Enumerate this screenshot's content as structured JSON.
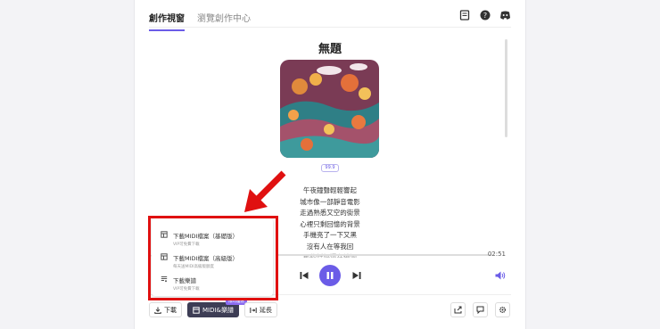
{
  "tabs": [
    "創作視窗",
    "瀏覽創作中心"
  ],
  "song": {
    "title": "無題",
    "tag": "99.9"
  },
  "lyrics": [
    "午夜鐘聲輕輕響起",
    "城市像一部靜音電影",
    "走過熟悉又空的街景",
    "心裡只剩回憶的背景",
    "手機亮了一下又黑",
    "沒有人在等我回",
    "那些話語還在繞迴"
  ],
  "player": {
    "time_end": "02:51",
    "progress": 0.0
  },
  "menu": {
    "items": [
      {
        "title": "下載MIDI檔案（基礎版）",
        "sub": "VIP可免費下載",
        "icon": "file-icon"
      },
      {
        "title": "下載MIDI檔案（高級版）",
        "sub": "每天送MIDI高級版額度",
        "icon": "file-icon"
      },
      {
        "title": "下載樂譜",
        "sub": "VIP可免費下載",
        "icon": "sheet-icon"
      }
    ]
  },
  "bottom": {
    "download": "下載",
    "midi": "MIDI&樂譜",
    "badge": "限時優惠",
    "extend": "延長"
  },
  "colors": {
    "accent": "#6b5ce7",
    "highlight": "#e01010"
  }
}
